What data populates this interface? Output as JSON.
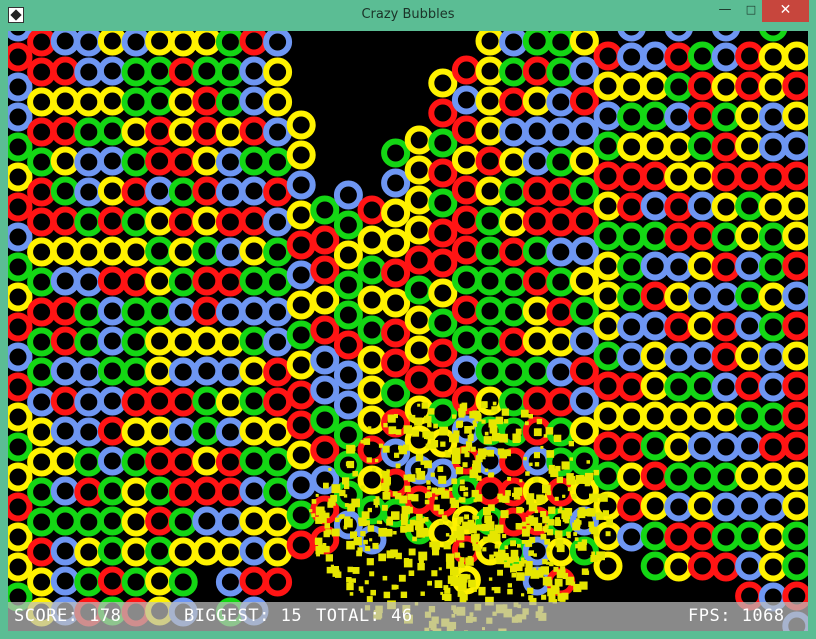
{
  "window": {
    "title": "Crazy Bubbles",
    "minimize_glyph": "—",
    "maximize_glyph": "□",
    "close_glyph": "✕"
  },
  "colors": {
    "red": "#ff1414",
    "green": "#14d614",
    "blue": "#6e96f2",
    "yellow": "#fff200",
    "particle": "#e6e600",
    "background": "#000000",
    "frame": "#5bbd94"
  },
  "hud": {
    "score": "SCORE: 178",
    "biggest": "BIGGEST: 15",
    "total": "TOTAL: 46",
    "fps": "FPS: 1068"
  },
  "board": {
    "columns": [
      "BRBBGYRBGYRBRYGYRYYG",
      "RRYRGRRYGRGGBYYGGRYY",
      "BRYRYGRYBRRBRBYBGBBB",
      "BBYGBBGYBGGBBBGRGYGR",
      "YBYGBYRYRBBGBRBGGGRG",
      "BGGYGRGYRGGGRYGYYYGR",
      "YGGRRBYGYGYYRYRGRGYY",
      "YRYYRGRYGBYBRBRRGYGB",
      "YGRRYRYGRRYBGGYRBY",
      "GGGYBBRBRBYBYBRRBYBG",
      "RBBRGBRYGBGYGYGBYBRB",
      "BYYBGRBGGBBRRYGGYYR",
      "YYBYRBYGYRRYBGR",
      "GRRYRBBGRBRR",
      "BGYGGRBBGGGB",
      "RYGYGYYYRYGB",
      "GBYYRYRRGRBRG",
      "YYYYRGYYRYYBRG",
      "YRGRGRRYGRRGYBRY",
      "RBRYRRRGRGBRBRGYRY",
      "YYYYRYGGGGGGYGBRGY",
      "BGRBYGYRGGRGGGRRRG",
      "GRYBBRRGRYYGRRBYRBB",
      "GGBBGRRBGRYBRGGRGYR",
      "YBRBYGRBYGBRBYGYBG",
      "RYBGRYGYYYGRYRGYYY",
      "BBYGYRRGGGBBRYRYRB",
      "BYGYRBGBRBYYYGRYGG",
      "BRGBYYRRBYRBGYYGBRY",
      "GRRGYBRYBYBGYBGYRR",
      "BBYGRRYGRBRRBYBGBGR",
      "RRYYRGYBGBYRGBYBGBR",
      "GYYBBRYGGYGBBGRYBYYB",
      "YRYBRYYRBRYRRRYYGGRB"
    ],
    "top_offsets": [
      0,
      0,
      1,
      0,
      1,
      0,
      1,
      0,
      1,
      0,
      1,
      0,
      7,
      12,
      12,
      12,
      9,
      7,
      4,
      2,
      1,
      0,
      1,
      0,
      1,
      1,
      0,
      1,
      0,
      1,
      0,
      1,
      0,
      1
    ]
  }
}
